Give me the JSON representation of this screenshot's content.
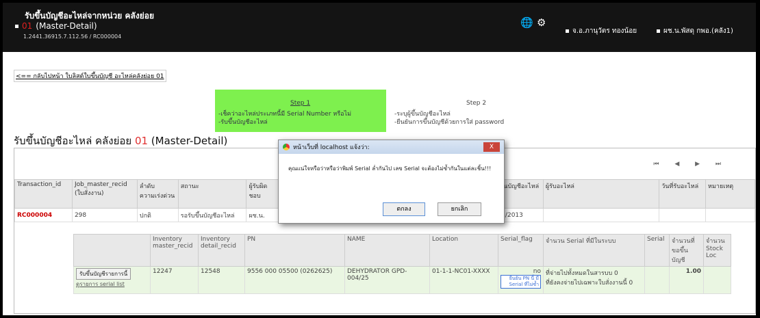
{
  "header": {
    "title": "รับขึ้นบัญชีอะไหล่จากหน่วย คลังย่อย",
    "code": "01",
    "subtitle": "(Master-Detail)",
    "address": "1.2441.36915.7.112.56 / RC000004",
    "user1": "จ.อ.ภานุวัตร ทองน้อย",
    "user2": "ผช.น.พัสดุ กพอ.(คลัง1)",
    "globe_icon": "globe-icon",
    "gear_icon": "gear-icon"
  },
  "back_link": "<== กลับไปหน้า ใบลิสต์ใบขึ้นบัญชี อะไหล่คลังย่อย 01",
  "step1": {
    "heading": "Step 1",
    "line1": "-เช็คว่าอะไหล่ประเภทนี้มี Serial Number หรือไม่",
    "line2": "-รับขึ้นบัญชีอะไหล่"
  },
  "step2": {
    "heading": "Step 2",
    "line1": "-ระบุผู้ขึ้นบัญชีอะไหล่",
    "line2": "-ยืนยันการขึ้นบัญชีด้วยการใส่ password"
  },
  "page_title": {
    "text": "รับขึ้นบัญชีอะไหล่ คลังย่อย ",
    "code": "01",
    "suffix": " (Master-Detail)"
  },
  "pager": "⏮ ◀ ▶ ⏭",
  "master_table": {
    "headers": [
      "Transaction_id",
      "Job_master_recid (ใบสั่งงาน)",
      "ลำดับความเร่งด่วน",
      "สถานะ",
      "ผู้รับผิดชอบ",
      "",
      "",
      "",
      "วันที่ขึ้นบัญชีอะไหล่",
      "ผู้รับอะไหล่",
      "วันที่รับอะไหล่",
      "หมายเหตุ"
    ],
    "row": [
      "RC000004",
      "298",
      "ปกติ",
      "รอรับขึ้นบัญชีอะไหล่",
      "ผช.น.",
      "",
      "",
      "",
      "18/02/2013",
      "",
      "",
      ""
    ]
  },
  "detail_table": {
    "headers": [
      "",
      "Inventory master_recid",
      "Inventory detail_recid",
      "PN",
      "NAME",
      "Location",
      "Serial_flag",
      "จำนวน Serial ที่มีในระบบ",
      "Serial",
      "จำนวนที่ขอขึ้นบัญชี",
      "จำนวน Stock Loc"
    ],
    "button": "รับขึ้นบัญชีรายการนี้",
    "link": "ดูรายการ serial list",
    "row": [
      "12247",
      "12548",
      "9556 000 05500 (0262625)",
      "DEHYDRATOR GPD-004/25",
      "01-1-1-NC01-XXXX",
      "no",
      "ที่จ่ายไปทั้งหมดในสารบบ 0",
      "ที่ยังคงจ่ายไปเฉพาะใบสั่งงานนี้ 0",
      "",
      "1.00",
      ""
    ],
    "badge": "ยืนยัน PN นี้ มี Serial ที่ไม่ซ้ำ"
  },
  "dialog": {
    "title": "หน้าเว็บที่ localhost แจ้งว่า:",
    "close": "X",
    "message": "คุณแน่ใจหรือว่าหรือว่าพิมพ์ Serial ล่ำกันไป เลข Serial จะต้องไม่ซ้ำกันในแต่ละชิ้น!!!",
    "ok": "ตกลง",
    "cancel": "ยกเลิก"
  }
}
